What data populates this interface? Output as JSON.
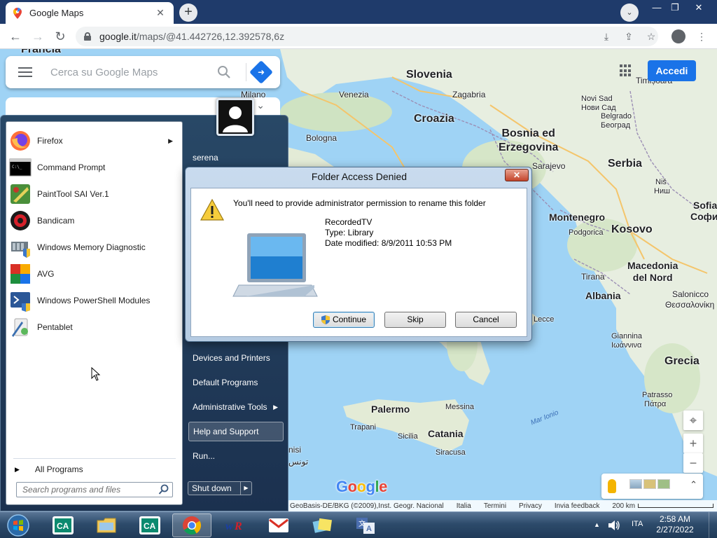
{
  "browser": {
    "tab_title": "Google Maps",
    "tab_close": "✕",
    "newtab": "+",
    "url_host": "google.it",
    "url_path": "/maps/@41.442726,12.392578,6z",
    "win_min": "—",
    "win_max": "❐",
    "win_close": "✕",
    "tabsearch": "⌄"
  },
  "maps": {
    "search_placeholder": "Cerca su Google Maps",
    "signin_label": "Accedi",
    "labels": {
      "francia": "Francia",
      "milano": "Milano",
      "slovenia": "Slovenia",
      "venezia": "Venezia",
      "zagabria": "Zagabria",
      "croazia": "Croazia",
      "bologna": "Bologna",
      "bosnia": "Bosnia ed\nErzegovina",
      "sarajevo": "Sarajevo",
      "serbia": "Serbia",
      "timisoara": "Timișoara",
      "novi_sad": "Novi Sad",
      "novi_sad_cyr": "Нови Сад",
      "belgrado": "Belgrado",
      "beograd": "Београд",
      "nis": "Niš",
      "nis_cyr": "Ниш",
      "sofia": "Sofia",
      "sofia_cyr": "София",
      "montenegro": "Montenegro",
      "kosovo": "Kosovo",
      "podgorica": "Podgorica",
      "tirana": "Tirana",
      "albania": "Albania",
      "macedonia": "Macedonia\ndel Nord",
      "salonicco": "Salonicco",
      "salonicco_gr": "Θεσσαλονίκη",
      "lecce": "Lecce",
      "giannina": "Giannina",
      "giannina_gr": "Ιωάννινα",
      "grecia": "Grecia",
      "patrasso": "Patrasso",
      "patrasso_gr": "Πάτρα",
      "palermo": "Palermo",
      "messina": "Messina",
      "trapani": "Trapani",
      "sicilia": "Sicilia",
      "catania": "Catania",
      "siracusa": "Siracusa",
      "mar_ionio": "Mar Ionio",
      "tunisi": "nisi",
      "tunisi_ar": "تونس"
    },
    "google_logo": [
      "G",
      "o",
      "o",
      "g",
      "l",
      "e"
    ],
    "attribution": [
      "GeoBasis-DE/BKG (©2009),Inst. Geogr. Nacional",
      "Italia",
      "Termini",
      "Privacy",
      "Invia feedback",
      "200 km"
    ],
    "zoom_in": "+",
    "zoom_out": "−",
    "expand": "⌃"
  },
  "start_menu": {
    "programs": [
      {
        "label": "Firefox",
        "has_submenu": true
      },
      {
        "label": "Command Prompt"
      },
      {
        "label": "PaintTool SAI Ver.1"
      },
      {
        "label": "Bandicam"
      },
      {
        "label": "Windows Memory Diagnostic"
      },
      {
        "label": "AVG"
      },
      {
        "label": "Windows PowerShell Modules"
      },
      {
        "label": "Pentablet"
      }
    ],
    "all_programs": "All Programs",
    "search_placeholder": "Search programs and files",
    "user": "serena",
    "right_items": [
      {
        "label": "Devices and Printers"
      },
      {
        "label": "Default Programs"
      },
      {
        "label": "Administrative Tools",
        "has_submenu": true
      },
      {
        "label": "Help and Support",
        "highlighted": true
      },
      {
        "label": "Run..."
      }
    ],
    "shutdown": "Shut down"
  },
  "dialog": {
    "title": "Folder Access Denied",
    "close": "✕",
    "message": "You'll need to provide administrator permission to rename this folder",
    "item_name": "RecordedTV",
    "item_type": "Type: Library",
    "item_modified": "Date modified: 8/9/2011 10:53 PM",
    "buttons": {
      "continue": "Continue",
      "skip": "Skip",
      "cancel": "Cancel"
    }
  },
  "taskbar": {
    "language": "ITA",
    "time": "2:58 AM",
    "date": "2/27/2022",
    "tray_arrow": "▲"
  },
  "colors": {
    "accent_blue": "#1a73e8",
    "tab_strip": "#1f3b6b",
    "sea": "#9fd3f5",
    "land": "#e9efe3"
  }
}
